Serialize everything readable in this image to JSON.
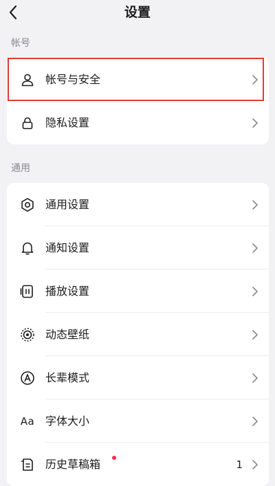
{
  "header": {
    "title": "设置",
    "back_icon": "chevron-left-icon"
  },
  "sections": {
    "account": {
      "label": "帐号",
      "items": [
        {
          "label": "帐号与安全",
          "icon": "user-icon"
        },
        {
          "label": "隐私设置",
          "icon": "lock-icon"
        }
      ]
    },
    "general": {
      "label": "通用",
      "items": [
        {
          "label": "通用设置",
          "icon": "gear-icon"
        },
        {
          "label": "通知设置",
          "icon": "bell-icon"
        },
        {
          "label": "播放设置",
          "icon": "play-settings-icon"
        },
        {
          "label": "动态壁纸",
          "icon": "wallpaper-icon"
        },
        {
          "label": "长辈模式",
          "icon": "elder-mode-icon"
        },
        {
          "label": "字体大小",
          "icon": "font-size-icon",
          "icon_text": "Aa"
        },
        {
          "label": "历史草稿箱",
          "icon": "drafts-icon",
          "value": "1",
          "badge_color": "#fe2c55"
        }
      ]
    }
  },
  "highlight_color": "#e53935"
}
